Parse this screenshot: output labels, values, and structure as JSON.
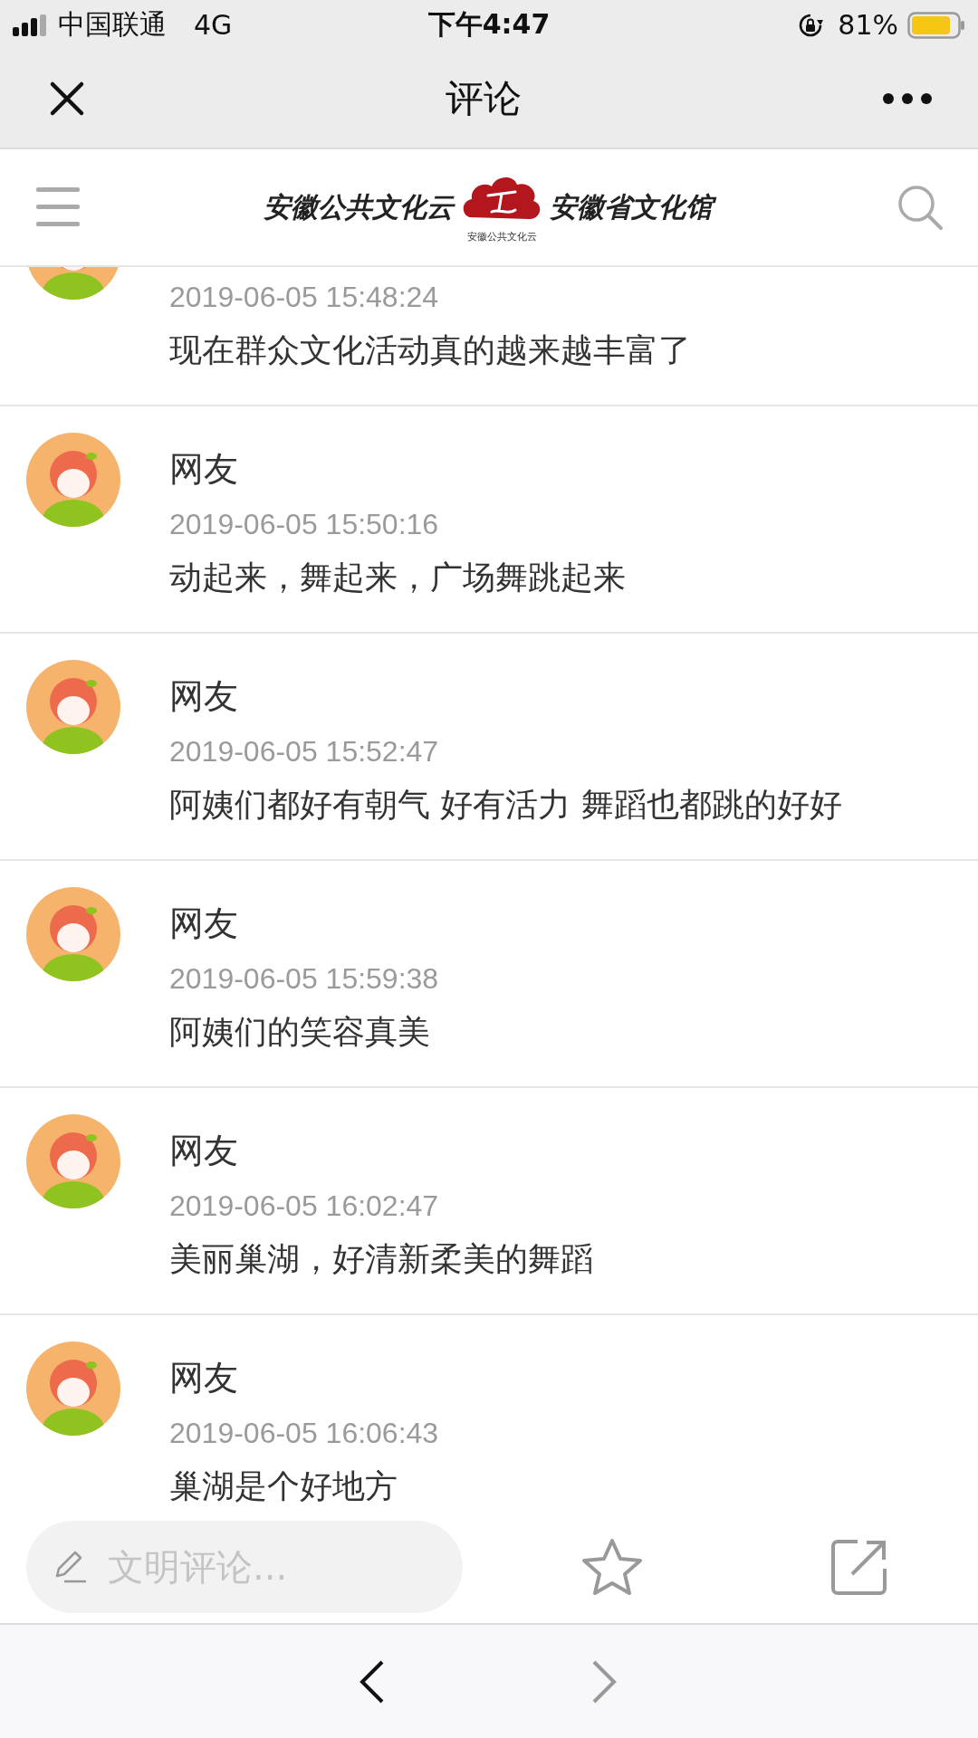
{
  "status_bar": {
    "carrier": "中国联通",
    "network": "4G",
    "time": "下午4:47",
    "battery": "81%"
  },
  "nav_bar": {
    "title": "评论"
  },
  "site_header": {
    "logo_left": "安徽公共文化云",
    "logo_small": "安徽公共文化云",
    "logo_right": "安徽省文化馆"
  },
  "comments": [
    {
      "time": "2019-06-05 15:48:24",
      "text": "现在群众文化活动真的越来越丰富了"
    },
    {
      "name": "网友",
      "time": "2019-06-05 15:50:16",
      "text": "动起来，舞起来，广场舞跳起来"
    },
    {
      "name": "网友",
      "time": "2019-06-05 15:52:47",
      "text": "阿姨们都好有朝气 好有活力 舞蹈也都跳的好好"
    },
    {
      "name": "网友",
      "time": "2019-06-05 15:59:38",
      "text": "阿姨们的笑容真美"
    },
    {
      "name": "网友",
      "time": "2019-06-05 16:02:47",
      "text": "美丽巢湖，好清新柔美的舞蹈"
    },
    {
      "name": "网友",
      "time": "2019-06-05 16:06:43",
      "text": "巢湖是个好地方"
    }
  ],
  "comment_bar": {
    "placeholder": "文明评论..."
  }
}
